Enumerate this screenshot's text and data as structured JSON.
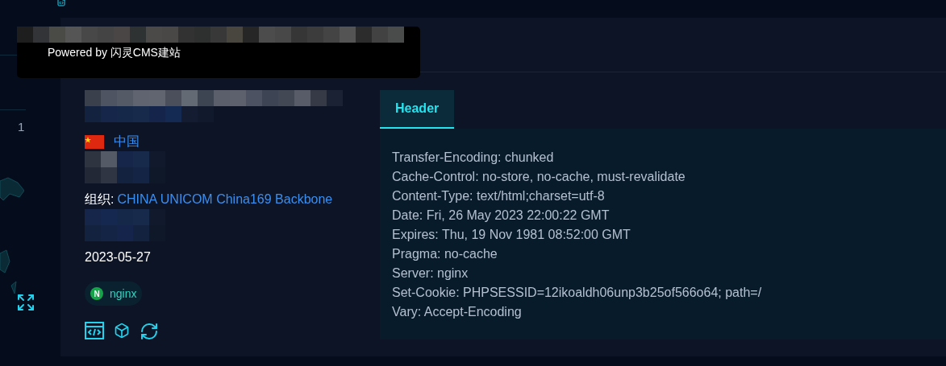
{
  "sidebar": {
    "page_number": "1"
  },
  "tooltip": {
    "text": "Powered by 闪灵CMS建站"
  },
  "host": {
    "country": "中国",
    "org_label": "组织:",
    "org": "CHINA UNICOM China169 Backbone",
    "date": "2023-05-27",
    "tags": [
      {
        "label": "nginx",
        "initial": "N"
      }
    ]
  },
  "tabs": [
    {
      "label": "Header",
      "selected": true
    }
  ],
  "headers": [
    "Transfer-Encoding: chunked",
    "Cache-Control: no-store, no-cache, must-revalidate",
    "Content-Type: text/html;charset=utf-8",
    "Date: Fri, 26 May 2023 22:00:22 GMT",
    "Expires: Thu, 19 Nov 1981 08:52:00 GMT",
    "Pragma: no-cache",
    "Server: nginx",
    "Set-Cookie: PHPSESSID=12ikoaldh06unp3b25of566o64; path=/",
    "Vary: Accept-Encoding"
  ]
}
